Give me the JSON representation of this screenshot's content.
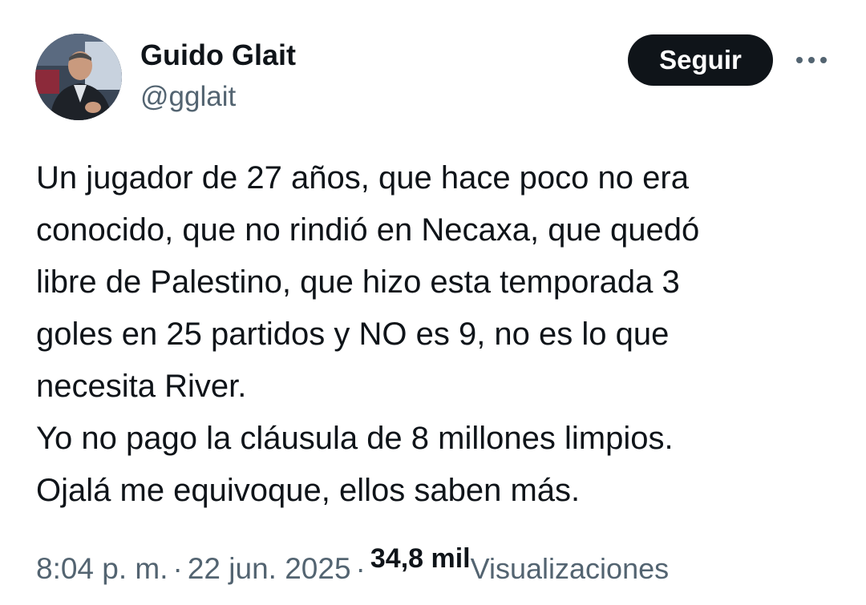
{
  "author": {
    "display_name": "Guido Glait",
    "handle": "@gglait",
    "avatar_icon": "profile-photo"
  },
  "actions": {
    "follow_label": "Seguir",
    "more_icon": "more-options-icon"
  },
  "tweet": {
    "text": "Un jugador de 27 años, que hace poco no era\nconocido, que no rindió en Necaxa, que quedó\nlibre de Palestino, que hizo esta temporada 3\ngoles en 25 partidos y NO es 9, no es lo que\nnecesita River.\nYo no pago la cláusula de 8 millones limpios.\nOjalá me equivoque, ellos saben más."
  },
  "meta": {
    "time": "8:04 p. m.",
    "separator": "·",
    "date": "22 jun. 2025",
    "views_count": "34,8 mil",
    "views_label": "Visualizaciones"
  },
  "colors": {
    "text_primary": "#0f1419",
    "text_secondary": "#536471",
    "button_bg": "#0f1419",
    "button_text": "#ffffff",
    "background": "#ffffff"
  }
}
